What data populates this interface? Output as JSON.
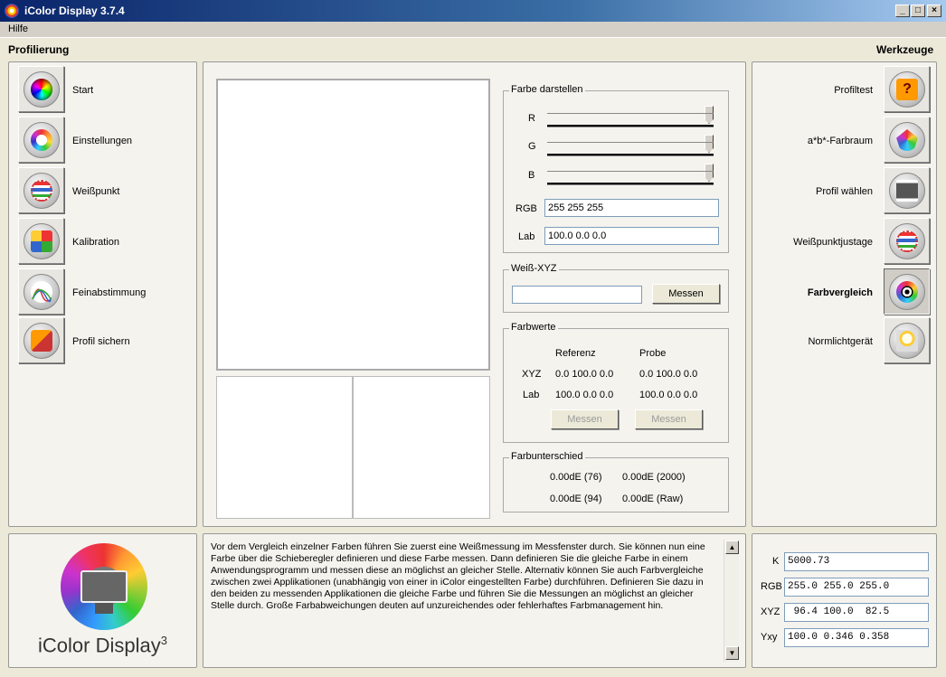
{
  "window": {
    "title": "iColor Display 3.7.4",
    "controls": {
      "minimize": "_",
      "maximize": "□",
      "close": "×"
    }
  },
  "menu": {
    "items": [
      "Hilfe"
    ]
  },
  "left": {
    "heading": "Profilierung",
    "items": [
      {
        "label": "Start",
        "icon": "color-wheel-icon"
      },
      {
        "label": "Einstellungen",
        "icon": "settings-dial-icon"
      },
      {
        "label": "Weißpunkt",
        "icon": "white-point-icon"
      },
      {
        "label": "Kalibration",
        "icon": "calibration-grid-icon"
      },
      {
        "label": "Feinabstimmung",
        "icon": "curves-icon"
      },
      {
        "label": "Profil sichern",
        "icon": "save-profile-icon"
      }
    ]
  },
  "right": {
    "heading": "Werkzeuge",
    "items": [
      {
        "label": "Profiltest",
        "icon": "question-icon"
      },
      {
        "label": "a*b*-Farbraum",
        "icon": "gamut-icon"
      },
      {
        "label": "Profil wählen",
        "icon": "select-profile-icon"
      },
      {
        "label": "Weißpunktjustage",
        "icon": "white-point-adjust-icon"
      },
      {
        "label": "Farbvergleich",
        "icon": "target-icon",
        "active": true
      },
      {
        "label": "Normlichtgerät",
        "icon": "light-bulb-icon"
      }
    ]
  },
  "color_display": {
    "title": "Farbe darstellen",
    "sliders": [
      {
        "label": "R",
        "value": 255,
        "max": 255
      },
      {
        "label": "G",
        "value": 255,
        "max": 255
      },
      {
        "label": "B",
        "value": 255,
        "max": 255
      }
    ],
    "rgb_label": "RGB",
    "rgb_value": "255 255 255",
    "lab_label": "Lab",
    "lab_value": "100.0 0.0 0.0"
  },
  "white_xyz": {
    "title": "Weiß-XYZ",
    "value": "",
    "measure_label": "Messen"
  },
  "color_values": {
    "title": "Farbwerte",
    "col_reference": "Referenz",
    "col_sample": "Probe",
    "rows": [
      {
        "label": "XYZ",
        "reference": "0.0 100.0 0.0",
        "sample": "0.0 100.0 0.0"
      },
      {
        "label": "Lab",
        "reference": "100.0 0.0 0.0",
        "sample": "100.0 0.0 0.0"
      }
    ],
    "measure_reference": "Messen",
    "measure_sample": "Messen"
  },
  "color_difference": {
    "title": "Farbunterschied",
    "values": [
      "0.00dE (76)",
      "0.00dE (2000)",
      "0.00dE (94)",
      "0.00dE (Raw)"
    ]
  },
  "logo": {
    "text": "iColor Display",
    "superscript": "3"
  },
  "help_text": "Vor dem Vergleich einzelner Farben führen Sie zuerst eine Weißmessung im Messfenster durch. Sie können nun eine Farbe über die Schieberegler definieren und diese Farbe messen. Dann definieren Sie die gleiche Farbe in einem Anwendungsprogramm und messen diese an möglichst an gleicher Stelle. Alternativ können Sie auch Farbvergleiche zwischen zwei Applikationen (unabhängig von einer in iColor eingestellten Farbe) durchführen. Definieren Sie dazu in den beiden zu messenden Applikationen die gleiche Farbe und führen Sie die Messungen an möglichst an gleicher Stelle durch. Große Farbabweichungen deuten auf unzureichendes oder fehlerhaftes Farbmanagement hin.",
  "readouts": [
    {
      "label": "K",
      "value": "5000.73"
    },
    {
      "label": "RGB",
      "value": "255.0 255.0 255.0"
    },
    {
      "label": "XYZ",
      "value": " 96.4 100.0  82.5"
    },
    {
      "label": "Yxy",
      "value": "100.0 0.346 0.358"
    }
  ]
}
